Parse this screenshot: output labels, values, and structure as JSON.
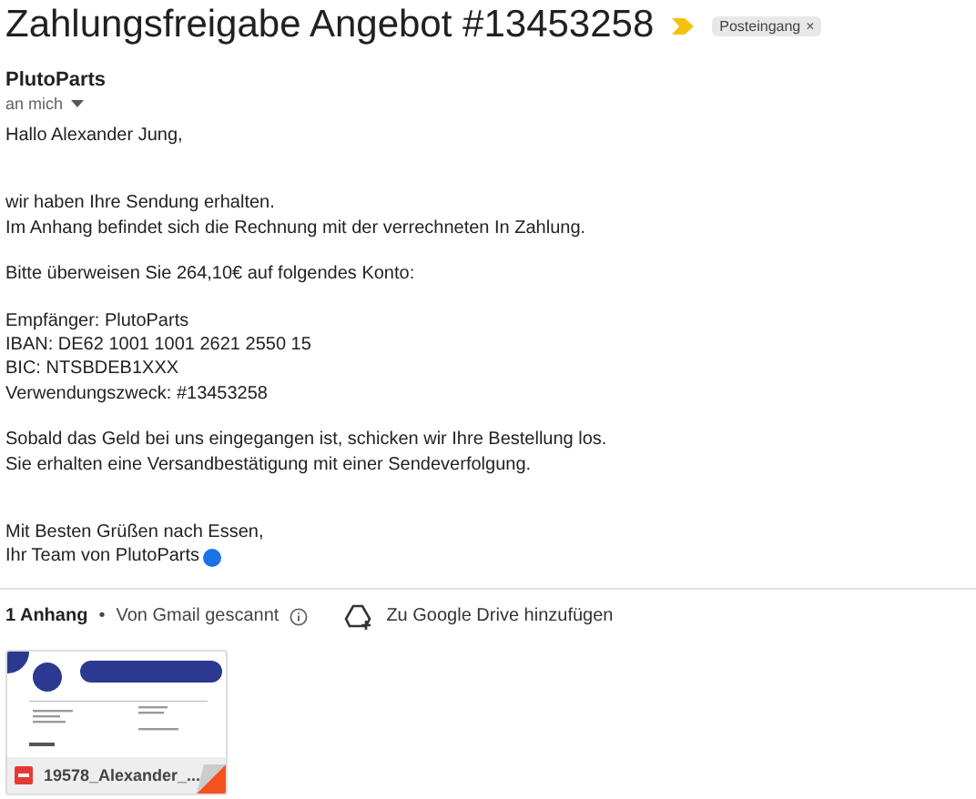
{
  "subject": "Zahlungsfreigabe Angebot #13453258",
  "important": true,
  "label": {
    "text": "Posteingang",
    "close": "×"
  },
  "sender": "PlutoParts",
  "recipient": "an mich",
  "body": [
    [
      "Hallo Alexander Jung,"
    ],
    [
      "wir haben Ihre Sendung erhalten.",
      "Im Anhang befindet sich die Rechnung mit der verrechneten In Zahlung."
    ],
    [
      "Bitte überweisen Sie 264,10€ auf folgendes Konto:"
    ],
    [
      "Empfänger: PlutoParts",
      "IBAN: DE62 1001 1001 2621 2550 15",
      "BIC: NTSBDEB1XXX",
      "Verwendungszweck: #13453258"
    ],
    [
      "Sobald das Geld bei uns eingegangen ist, schicken wir Ihre Bestellung los.",
      "Sie erhalten eine Versandbestätigung mit einer Sendeverfolgung."
    ],
    [
      "Mit Besten Grüßen nach Essen,",
      "Ihr Team von PlutoParts"
    ]
  ],
  "attachments_bar": {
    "count": "1 Anhang",
    "separator": "•",
    "scan": "Von Gmail gescannt",
    "drive": "Zu Google Drive hinzufügen"
  },
  "attachments": [
    {
      "file": "19578_Alexander_..."
    }
  ]
}
